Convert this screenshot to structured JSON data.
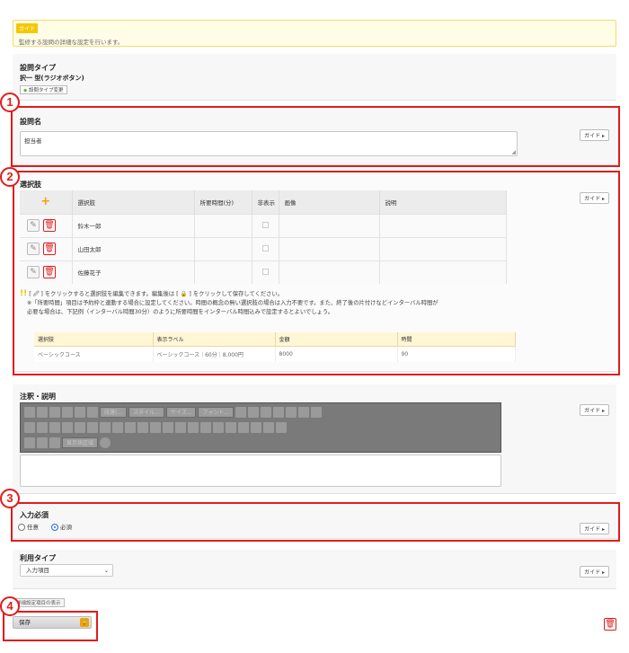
{
  "guide": {
    "tag": "ガイド",
    "text": "監修する設問の詳細な設定を行います。"
  },
  "question_type": {
    "label": "設問タイプ",
    "value": "択一 型(ラジオボタン)",
    "change_label": "設問タイプ変更"
  },
  "question_name": {
    "label": "設問名",
    "value": "担当者",
    "guide_label": "ガイド ▸"
  },
  "choices": {
    "label": "選択肢",
    "guide_label": "ガイド ▸",
    "columns": [
      "選択肢",
      "所要時間(分)",
      "非表示",
      "画像",
      "説明"
    ],
    "rows": [
      {
        "name": "鈴木一郎"
      },
      {
        "name": "山田太郎"
      },
      {
        "name": "佐藤花子"
      }
    ],
    "note_line1": "[ 🖉 ] をクリックすると選択肢を編集できます。編集後は [ 🔒 ] をクリックして保存してください。",
    "note_line2": "※「所要時間」項目は予約枠と連動する場合に設定してください。時間の概念の無い選択肢の場合は入力不要です。また、終了後の片付けなどインターバル時間が",
    "note_line3": "必要な場合は、下記例（インターバル時間30分）のように所要時間をインターバル時間込みで設定するとよいでしょう。",
    "example_columns": [
      "選択肢",
      "表示ラベル",
      "金額",
      "時間"
    ],
    "example_row": [
      "ベーシックコース",
      "ベーシックコース｜60分｜8,000円",
      "8000",
      "90"
    ]
  },
  "notes": {
    "label": "注釈・説明",
    "guide_label": "ガイド ▸",
    "toolbar": {
      "paragraph": "段落(...",
      "style": "スタイル...",
      "size": "サイズ...",
      "font": "フォント...",
      "display": "显示块区域"
    }
  },
  "required": {
    "label": "入力必須",
    "option_optional": "任意",
    "option_required": "必須",
    "guide_label": "ガイド ▸"
  },
  "usage_type": {
    "label": "利用タイプ",
    "value": "入力項目",
    "guide_label": "ガイド ▸"
  },
  "advanced_link": "詳細設定項目の表示",
  "save_label": "保存",
  "markers": [
    "1",
    "2",
    "3",
    "4"
  ],
  "colors": {
    "accent_red": "#e21b1b",
    "guide_yellow": "#f3c800",
    "panel_bg": "#f7f7f7"
  }
}
